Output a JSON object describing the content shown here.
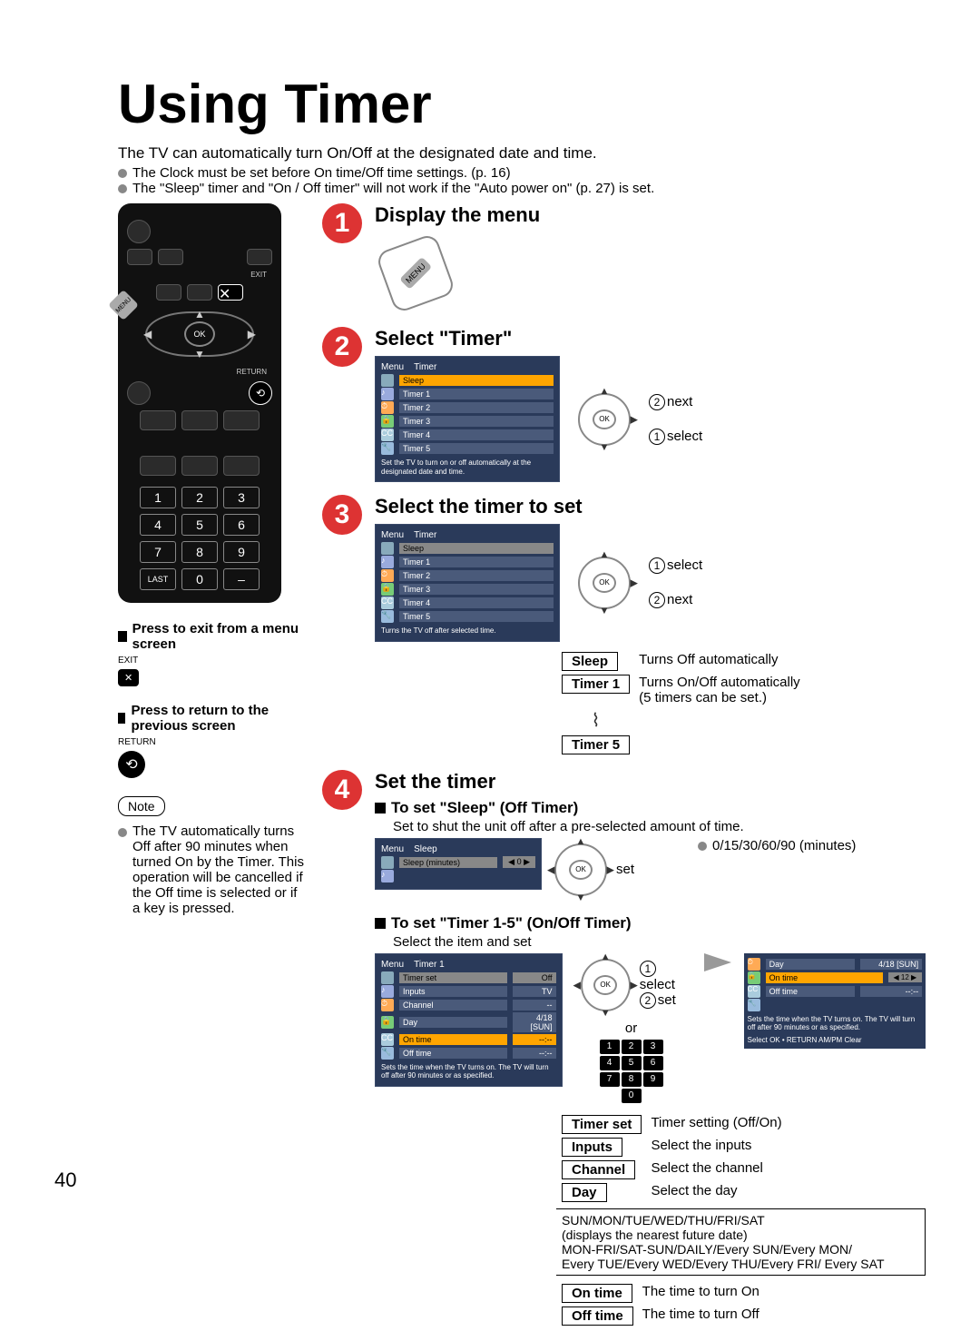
{
  "page_number": "40",
  "title": "Using Timer",
  "intro": "The TV can automatically turn On/Off at the designated date and time.",
  "bullets": [
    "The Clock must be set before On time/Off time settings. (p. 16)",
    "The \"Sleep\" timer and \"On / Off timer\" will not work if the \"Auto power on\" (p. 27) is set."
  ],
  "remote": {
    "ok": "OK",
    "exit": "EXIT",
    "return": "RETURN",
    "last": "LAST",
    "menu_tag": "MENU"
  },
  "help": {
    "exit_title": "Press to exit from a menu screen",
    "exit_label": "EXIT",
    "return_title": "Press to return to the previous screen",
    "return_label": "RETURN"
  },
  "note": {
    "label": "Note",
    "text": "The TV automatically turns Off after 90 minutes when turned On by the Timer. This operation will be cancelled if the Off time is selected or if a key is pressed."
  },
  "steps": {
    "s1": {
      "num": "1",
      "title": "Display the menu",
      "btn": "MENU"
    },
    "s2": {
      "num": "2",
      "title": "Select \"Timer\"",
      "osd_header": "Menu",
      "osd_column": "Timer",
      "items": [
        "Sleep",
        "Timer 1",
        "Timer 2",
        "Timer 3",
        "Timer 4",
        "Timer 5"
      ],
      "osd_footer": "Set the TV to turn on or off automatically at the designated date and time.",
      "anno1": "next",
      "anno2": "select"
    },
    "s3": {
      "num": "3",
      "title": "Select the timer to set",
      "osd_header": "Menu",
      "osd_column": "Timer",
      "items": [
        "Sleep",
        "Timer 1",
        "Timer 2",
        "Timer 3",
        "Timer 4",
        "Timer 5"
      ],
      "osd_footer": "Turns the TV off after selected time.",
      "anno1": "select",
      "anno2": "next",
      "pill_sleep": "Sleep",
      "pill_timer1": "Timer 1",
      "pill_timer5": "Timer 5",
      "desc_sleep": "Turns Off automatically",
      "desc_timer1a": "Turns On/Off automatically",
      "desc_timer1b": "(5 timers can be set.)"
    },
    "s4": {
      "num": "4",
      "title": "Set the timer",
      "sleep_sub": "To set \"Sleep\" (Off Timer)",
      "sleep_body": "Set to shut the unit off after a pre-selected amount of time.",
      "sleep_values": "0/15/30/60/90 (minutes)",
      "sleep_anno": "set",
      "sleep_osd": {
        "header": "Menu",
        "col": "Sleep",
        "row": "Sleep (minutes)",
        "val": "0"
      },
      "onoff_sub": "To set \"Timer 1-5\" (On/Off Timer)",
      "onoff_body": "Select the item and set",
      "onoff_anno1": "select",
      "onoff_anno2": "set",
      "or": "or",
      "osd_items": {
        "header": "Menu",
        "col": "Timer 1",
        "rows": [
          {
            "k": "Timer set",
            "v": "Off"
          },
          {
            "k": "Inputs",
            "v": "TV"
          },
          {
            "k": "Channel",
            "v": "--"
          },
          {
            "k": "Day",
            "v": "4/18 [SUN]"
          },
          {
            "k": "On time",
            "v": "--:--"
          },
          {
            "k": "Off time",
            "v": "--:--"
          }
        ],
        "footer": "Sets the time when the TV turns on. The TV will turn off after 90 minutes or as specified."
      },
      "osd_right": {
        "rows": [
          {
            "k": "Day",
            "v": "4/18 [SUN]"
          },
          {
            "k": "On time",
            "v": "12"
          },
          {
            "k": "Off time",
            "v": "--:--"
          }
        ],
        "footer": "Sets the time when the TV turns on. The TV will turn off after 90 minutes or as specified.",
        "hint": "Select   OK • RETURN    AM/PM Clear"
      },
      "table": [
        {
          "k": "Timer set",
          "v": "Timer setting (Off/On)"
        },
        {
          "k": "Inputs",
          "v": "Select the inputs"
        },
        {
          "k": "Channel",
          "v": "Select the channel"
        },
        {
          "k": "Day",
          "v": "Select the day"
        }
      ],
      "day_list1": "SUN/MON/TUE/WED/THU/FRI/SAT",
      "day_list1b": "(displays the nearest future date)",
      "day_list2": "MON-FRI/SAT-SUN/DAILY/Every SUN/Every MON/",
      "day_list3": "Every TUE/Every WED/Every THU/Every FRI/ Every SAT",
      "table2": [
        {
          "k": "On time",
          "v": "The time to turn On"
        },
        {
          "k": "Off time",
          "v": "The time to turn Off"
        }
      ]
    }
  }
}
